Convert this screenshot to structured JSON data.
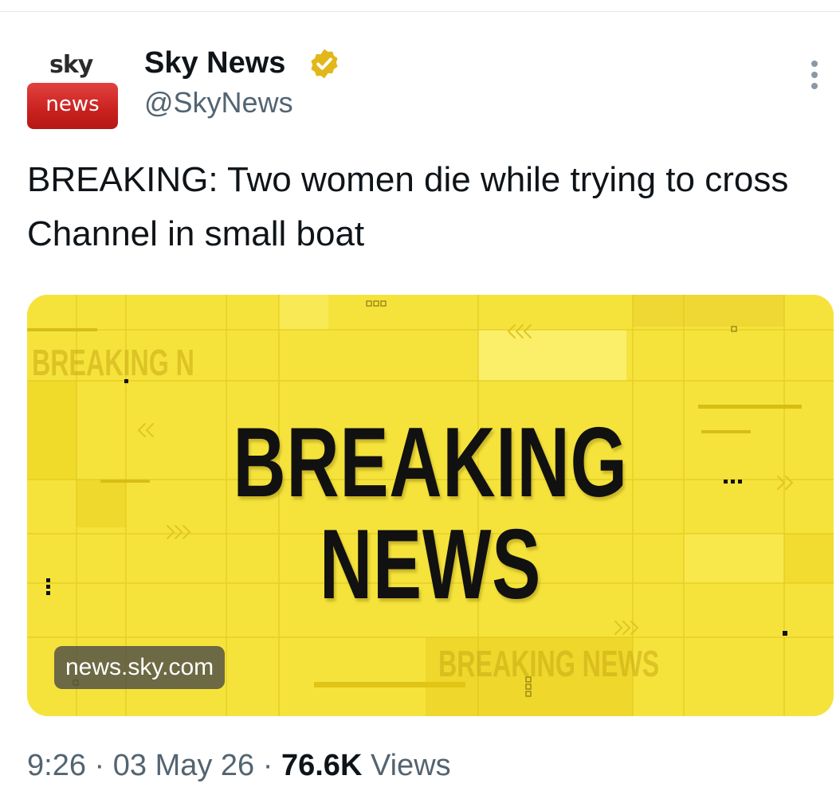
{
  "account": {
    "avatar_top": "sky",
    "avatar_bottom": "news",
    "name": "Sky News",
    "handle": "@SkyNews",
    "verified_icon": "gold-verified-badge-icon"
  },
  "tweet": {
    "text": "BREAKING: Two women die while trying to cross Channel in small boat"
  },
  "card": {
    "line1": "BREAKING",
    "line2": "NEWS",
    "ghost_text_left": "BREAKING N",
    "ghost_text_bottom": "BREAKING NEWS",
    "domain": "news.sky.com",
    "background_color": "#f5e33c"
  },
  "meta": {
    "time": "9:26",
    "sep1": "·",
    "date": "03 May 26",
    "sep2": "·",
    "views_count": "76.6K",
    "views_label": "Views"
  },
  "icons": {
    "more": "more-options-icon"
  }
}
